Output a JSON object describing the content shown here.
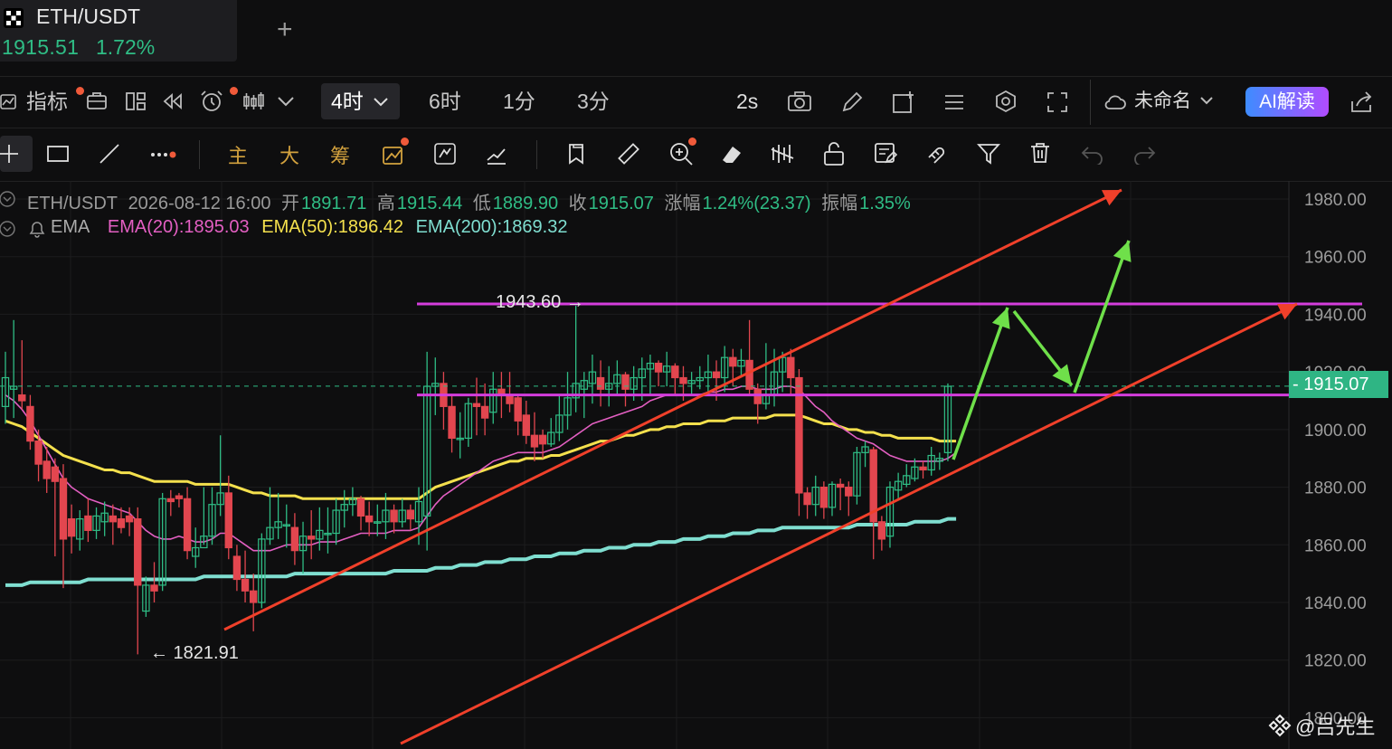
{
  "tab": {
    "pair": "ETH/USDT",
    "price": "1915.51",
    "change": "1.72%"
  },
  "toolbar": {
    "indicators_label": "指标",
    "timeframes": [
      "4时",
      "6时",
      "1分",
      "3分"
    ],
    "active_timeframe": "4时",
    "interval_label": "2s",
    "layout_name": "未命名",
    "ai_label": "AI解读"
  },
  "drawing_tools": {
    "main": "主",
    "big": "大",
    "chip": "筹"
  },
  "ohlc": {
    "symbol": "ETH/USDT",
    "time": "2026-08-12 16:00",
    "open_label": "开",
    "open": "1891.71",
    "high_label": "高",
    "high": "1915.44",
    "low_label": "低",
    "low": "1889.90",
    "close_label": "收",
    "close": "1915.07",
    "chg_label": "涨幅",
    "chg": "1.24%(23.37)",
    "amp_label": "振幅",
    "amp": "1.35%"
  },
  "ema": {
    "name": "EMA",
    "ema20": "EMA(20):1895.03",
    "ema50": "EMA(50):1896.42",
    "ema200": "EMA(200):1869.32"
  },
  "chart_data": {
    "type": "candlestick",
    "ylim": [
      1802,
      1985
    ],
    "y_ticks": [
      1800,
      1820,
      1840,
      1860,
      1880,
      1900,
      1920,
      1940,
      1960,
      1980
    ],
    "y_tick_labels": [
      "1800.00",
      "1820.00",
      "1840.00",
      "1860.00",
      "1880.00",
      "1900.00",
      "1920.00",
      "1940.00",
      "1960.00",
      "1980.00"
    ],
    "current_price": 1915.07,
    "current_price_label": "1915.07",
    "low_annotation": "← 1821.91",
    "high_annotation": "1943.60 →",
    "low_value": 1821.91,
    "high_value": 1943.6,
    "candles": [
      [
        1918,
        1908,
        1927,
        1902
      ],
      [
        1915,
        1914,
        1938,
        1904
      ],
      [
        1910,
        1912,
        1931,
        1907
      ],
      [
        1896,
        1908,
        1912,
        1893
      ],
      [
        1888,
        1896,
        1900,
        1882
      ],
      [
        1883,
        1889,
        1894,
        1878
      ],
      [
        1882,
        1887,
        1890,
        1856
      ],
      [
        1862,
        1883,
        1888,
        1845
      ],
      [
        1863,
        1869,
        1874,
        1857
      ],
      [
        1869,
        1862,
        1872,
        1858
      ],
      [
        1865,
        1870,
        1876,
        1861
      ],
      [
        1870,
        1865,
        1873,
        1862
      ],
      [
        1871,
        1868,
        1875,
        1863
      ],
      [
        1868,
        1870,
        1874,
        1860
      ],
      [
        1866,
        1869,
        1873,
        1864
      ],
      [
        1868,
        1870,
        1873,
        1863
      ],
      [
        1846,
        1869,
        1873,
        1822
      ],
      [
        1846,
        1837,
        1849,
        1835
      ],
      [
        1844,
        1846,
        1854,
        1840
      ],
      [
        1876,
        1846,
        1878,
        1844
      ],
      [
        1875,
        1876,
        1879,
        1870
      ],
      [
        1876,
        1877,
        1878,
        1873
      ],
      [
        1858,
        1876,
        1880,
        1855
      ],
      [
        1859,
        1856,
        1866,
        1852
      ],
      [
        1863,
        1859,
        1880,
        1860
      ],
      [
        1874,
        1863,
        1880,
        1860
      ],
      [
        1878,
        1874,
        1898,
        1870
      ],
      [
        1859,
        1878,
        1884,
        1855
      ],
      [
        1848,
        1856,
        1860,
        1844
      ],
      [
        1844,
        1848,
        1858,
        1840
      ],
      [
        1840,
        1844,
        1850,
        1830
      ],
      [
        1862,
        1840,
        1864,
        1838
      ],
      [
        1866,
        1862,
        1880,
        1860
      ],
      [
        1868,
        1866,
        1878,
        1862
      ],
      [
        1867,
        1867,
        1874,
        1859
      ],
      [
        1858,
        1866,
        1871,
        1853
      ],
      [
        1863,
        1858,
        1868,
        1850
      ],
      [
        1862,
        1863,
        1872,
        1855
      ],
      [
        1865,
        1862,
        1873,
        1858
      ],
      [
        1864,
        1864,
        1873,
        1857
      ],
      [
        1872,
        1864,
        1876,
        1860
      ],
      [
        1874,
        1872,
        1879,
        1866
      ],
      [
        1876,
        1874,
        1880,
        1870
      ],
      [
        1870,
        1876,
        1877,
        1865
      ],
      [
        1868,
        1870,
        1875,
        1863
      ],
      [
        1868,
        1868,
        1874,
        1863
      ],
      [
        1872,
        1868,
        1878,
        1862
      ],
      [
        1868,
        1872,
        1874,
        1864
      ],
      [
        1872,
        1868,
        1876,
        1866
      ],
      [
        1869,
        1872,
        1874,
        1865
      ],
      [
        1875,
        1868,
        1880,
        1860
      ],
      [
        1915,
        1870,
        1927,
        1858
      ],
      [
        1916,
        1915,
        1925,
        1905
      ],
      [
        1908,
        1916,
        1920,
        1900
      ],
      [
        1897,
        1908,
        1912,
        1892
      ],
      [
        1897,
        1897,
        1906,
        1890
      ],
      [
        1909,
        1897,
        1911,
        1894
      ],
      [
        1908,
        1909,
        1918,
        1898
      ],
      [
        1904,
        1908,
        1916,
        1898
      ],
      [
        1914,
        1906,
        1920,
        1902
      ],
      [
        1912,
        1914,
        1920,
        1904
      ],
      [
        1909,
        1912,
        1920,
        1906
      ],
      [
        1903,
        1911,
        1912,
        1898
      ],
      [
        1898,
        1905,
        1910,
        1895
      ],
      [
        1894,
        1898,
        1906,
        1889
      ],
      [
        1895,
        1898,
        1900,
        1890
      ],
      [
        1899,
        1895,
        1904,
        1894
      ],
      [
        1905,
        1899,
        1912,
        1896
      ],
      [
        1911,
        1905,
        1920,
        1900
      ],
      [
        1916,
        1911,
        1943,
        1906
      ],
      [
        1917,
        1914,
        1920,
        1904
      ],
      [
        1920,
        1916,
        1926,
        1909
      ],
      [
        1914,
        1918,
        1924,
        1908
      ],
      [
        1916,
        1914,
        1922,
        1908
      ],
      [
        1919,
        1916,
        1924,
        1912
      ],
      [
        1914,
        1919,
        1920,
        1908
      ],
      [
        1918,
        1914,
        1922,
        1910
      ],
      [
        1921,
        1918,
        1925,
        1910
      ],
      [
        1923,
        1921,
        1926,
        1912
      ],
      [
        1920,
        1923,
        1924,
        1915
      ],
      [
        1922,
        1920,
        1927,
        1915
      ],
      [
        1918,
        1922,
        1923,
        1912
      ],
      [
        1916,
        1918,
        1922,
        1910
      ],
      [
        1917,
        1916,
        1920,
        1912
      ],
      [
        1918,
        1917,
        1922,
        1914
      ],
      [
        1920,
        1918,
        1926,
        1912
      ],
      [
        1918,
        1920,
        1924,
        1910
      ],
      [
        1925,
        1918,
        1929,
        1913
      ],
      [
        1922,
        1925,
        1928,
        1915
      ],
      [
        1924,
        1922,
        1928,
        1918
      ],
      [
        1914,
        1924,
        1938,
        1912
      ],
      [
        1909,
        1914,
        1916,
        1902
      ],
      [
        1912,
        1909,
        1930,
        1907
      ],
      [
        1920,
        1912,
        1928,
        1908
      ],
      [
        1925,
        1920,
        1927,
        1913
      ],
      [
        1918,
        1925,
        1928,
        1912
      ],
      [
        1878,
        1918,
        1921,
        1870
      ],
      [
        1874,
        1878,
        1880,
        1869
      ],
      [
        1880,
        1874,
        1884,
        1870
      ],
      [
        1873,
        1880,
        1882,
        1869
      ],
      [
        1881,
        1873,
        1882,
        1870
      ],
      [
        1880,
        1881,
        1883,
        1872
      ],
      [
        1877,
        1880,
        1882,
        1870
      ],
      [
        1892,
        1877,
        1894,
        1874
      ],
      [
        1894,
        1892,
        1896,
        1887
      ],
      [
        1868,
        1893,
        1894,
        1855
      ],
      [
        1862,
        1868,
        1870,
        1858
      ],
      [
        1880,
        1863,
        1882,
        1859
      ],
      [
        1882,
        1879,
        1885,
        1876
      ],
      [
        1884,
        1881,
        1888,
        1880
      ],
      [
        1887,
        1883,
        1890,
        1882
      ],
      [
        1886,
        1887,
        1889,
        1883
      ],
      [
        1891,
        1886,
        1894,
        1884
      ],
      [
        1890,
        1889,
        1892,
        1886
      ],
      [
        1915,
        1892,
        1916,
        1889
      ]
    ],
    "ema20": [
      1912,
      1910,
      1907,
      1903,
      1898,
      1893,
      1888,
      1883,
      1880,
      1878,
      1876,
      1875,
      1874,
      1873,
      1872,
      1871,
      1868,
      1865,
      1863,
      1862,
      1862,
      1863,
      1862,
      1861,
      1861,
      1862,
      1864,
      1864,
      1862,
      1860,
      1858,
      1858,
      1858,
      1859,
      1860,
      1860,
      1860,
      1860,
      1861,
      1861,
      1861,
      1862,
      1863,
      1864,
      1864,
      1864,
      1864,
      1865,
      1865,
      1865,
      1866,
      1870,
      1874,
      1877,
      1879,
      1881,
      1883,
      1885,
      1887,
      1889,
      1890,
      1891,
      1892,
      1892,
      1892,
      1892,
      1893,
      1894,
      1896,
      1898,
      1900,
      1902,
      1903,
      1904,
      1905,
      1906,
      1907,
      1908,
      1910,
      1911,
      1912,
      1912,
      1912,
      1912,
      1912,
      1913,
      1913,
      1914,
      1914,
      1915,
      1915,
      1914,
      1914,
      1914,
      1915,
      1915,
      1914,
      1911,
      1908,
      1906,
      1903,
      1901,
      1899,
      1897,
      1896,
      1895,
      1893,
      1891,
      1890,
      1889,
      1889,
      1889,
      1889,
      1889,
      1890,
      1892
    ],
    "ema50": [
      1903,
      1902,
      1901,
      1899,
      1897,
      1895,
      1893,
      1891,
      1890,
      1889,
      1888,
      1887,
      1886,
      1886,
      1885,
      1885,
      1884,
      1883,
      1882,
      1882,
      1882,
      1882,
      1882,
      1881,
      1881,
      1881,
      1881,
      1881,
      1880,
      1879,
      1878,
      1878,
      1877,
      1877,
      1877,
      1877,
      1876,
      1876,
      1876,
      1876,
      1876,
      1876,
      1876,
      1876,
      1876,
      1876,
      1876,
      1876,
      1876,
      1876,
      1876,
      1878,
      1880,
      1881,
      1882,
      1883,
      1884,
      1885,
      1886,
      1887,
      1888,
      1889,
      1889,
      1890,
      1890,
      1890,
      1891,
      1891,
      1892,
      1893,
      1894,
      1895,
      1896,
      1896,
      1897,
      1898,
      1898,
      1899,
      1900,
      1900,
      1901,
      1901,
      1902,
      1902,
      1902,
      1903,
      1903,
      1903,
      1904,
      1904,
      1904,
      1904,
      1904,
      1905,
      1905,
      1905,
      1905,
      1904,
      1903,
      1902,
      1902,
      1901,
      1900,
      1900,
      1899,
      1899,
      1898,
      1898,
      1897,
      1897,
      1897,
      1897,
      1897,
      1896,
      1896,
      1896
    ],
    "ema200": [
      1846,
      1846,
      1846,
      1847,
      1847,
      1847,
      1847,
      1847,
      1847,
      1847,
      1848,
      1848,
      1848,
      1848,
      1848,
      1848,
      1848,
      1848,
      1848,
      1848,
      1848,
      1848,
      1848,
      1848,
      1849,
      1849,
      1849,
      1849,
      1849,
      1849,
      1849,
      1849,
      1849,
      1849,
      1849,
      1850,
      1850,
      1850,
      1850,
      1850,
      1850,
      1850,
      1850,
      1850,
      1850,
      1850,
      1850,
      1851,
      1851,
      1851,
      1851,
      1851,
      1852,
      1852,
      1852,
      1853,
      1853,
      1853,
      1854,
      1854,
      1854,
      1855,
      1855,
      1855,
      1856,
      1856,
      1856,
      1857,
      1857,
      1857,
      1858,
      1858,
      1858,
      1859,
      1859,
      1859,
      1860,
      1860,
      1860,
      1861,
      1861,
      1861,
      1862,
      1862,
      1862,
      1863,
      1863,
      1863,
      1864,
      1864,
      1864,
      1865,
      1865,
      1865,
      1866,
      1866,
      1866,
      1866,
      1866,
      1866,
      1866,
      1866,
      1866,
      1867,
      1867,
      1867,
      1867,
      1867,
      1867,
      1867,
      1868,
      1868,
      1868,
      1868,
      1869,
      1869
    ],
    "horizontal_lines": [
      1943.6,
      1912
    ],
    "trend_lines": [
      {
        "from": [
          0,
          1830
        ],
        "to": [
          1,
          1980
        ]
      },
      {
        "from": [
          0,
          1800
        ],
        "to": [
          1,
          1942
        ]
      }
    ]
  },
  "watermark": "@吕先生",
  "colors": {
    "up": "#2fbd85",
    "down": "#e2464f",
    "ema20": "#e35fc2",
    "ema50": "#f4e04d",
    "ema200": "#7fded0",
    "hline": "#d43ddc",
    "trend": "#f0402a",
    "arrow": "#6fe04a",
    "bg": "#0e0e0f"
  }
}
